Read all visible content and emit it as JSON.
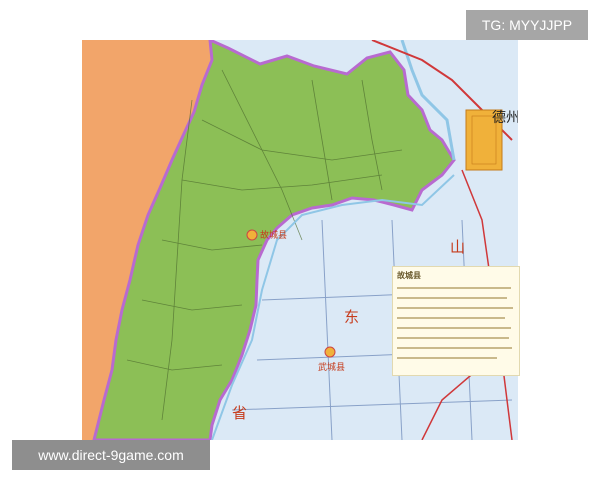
{
  "watermark_tag": "TG: MYYJJPP",
  "footer_url": "www.direct-9game.com",
  "map": {
    "city_label": "德州市",
    "county_label": "武城县",
    "town_label": "故城县",
    "province_chars": [
      "山",
      "东",
      "省"
    ],
    "note_title": "故城县",
    "colors": {
      "county": "#8cbf56",
      "county_border": "#b86ad0",
      "west_region": "#f2a56a",
      "east_region": "#d8e8f6",
      "water": "#8fc6e6",
      "city": "#f0b13a",
      "rail": "#d0383a"
    }
  }
}
